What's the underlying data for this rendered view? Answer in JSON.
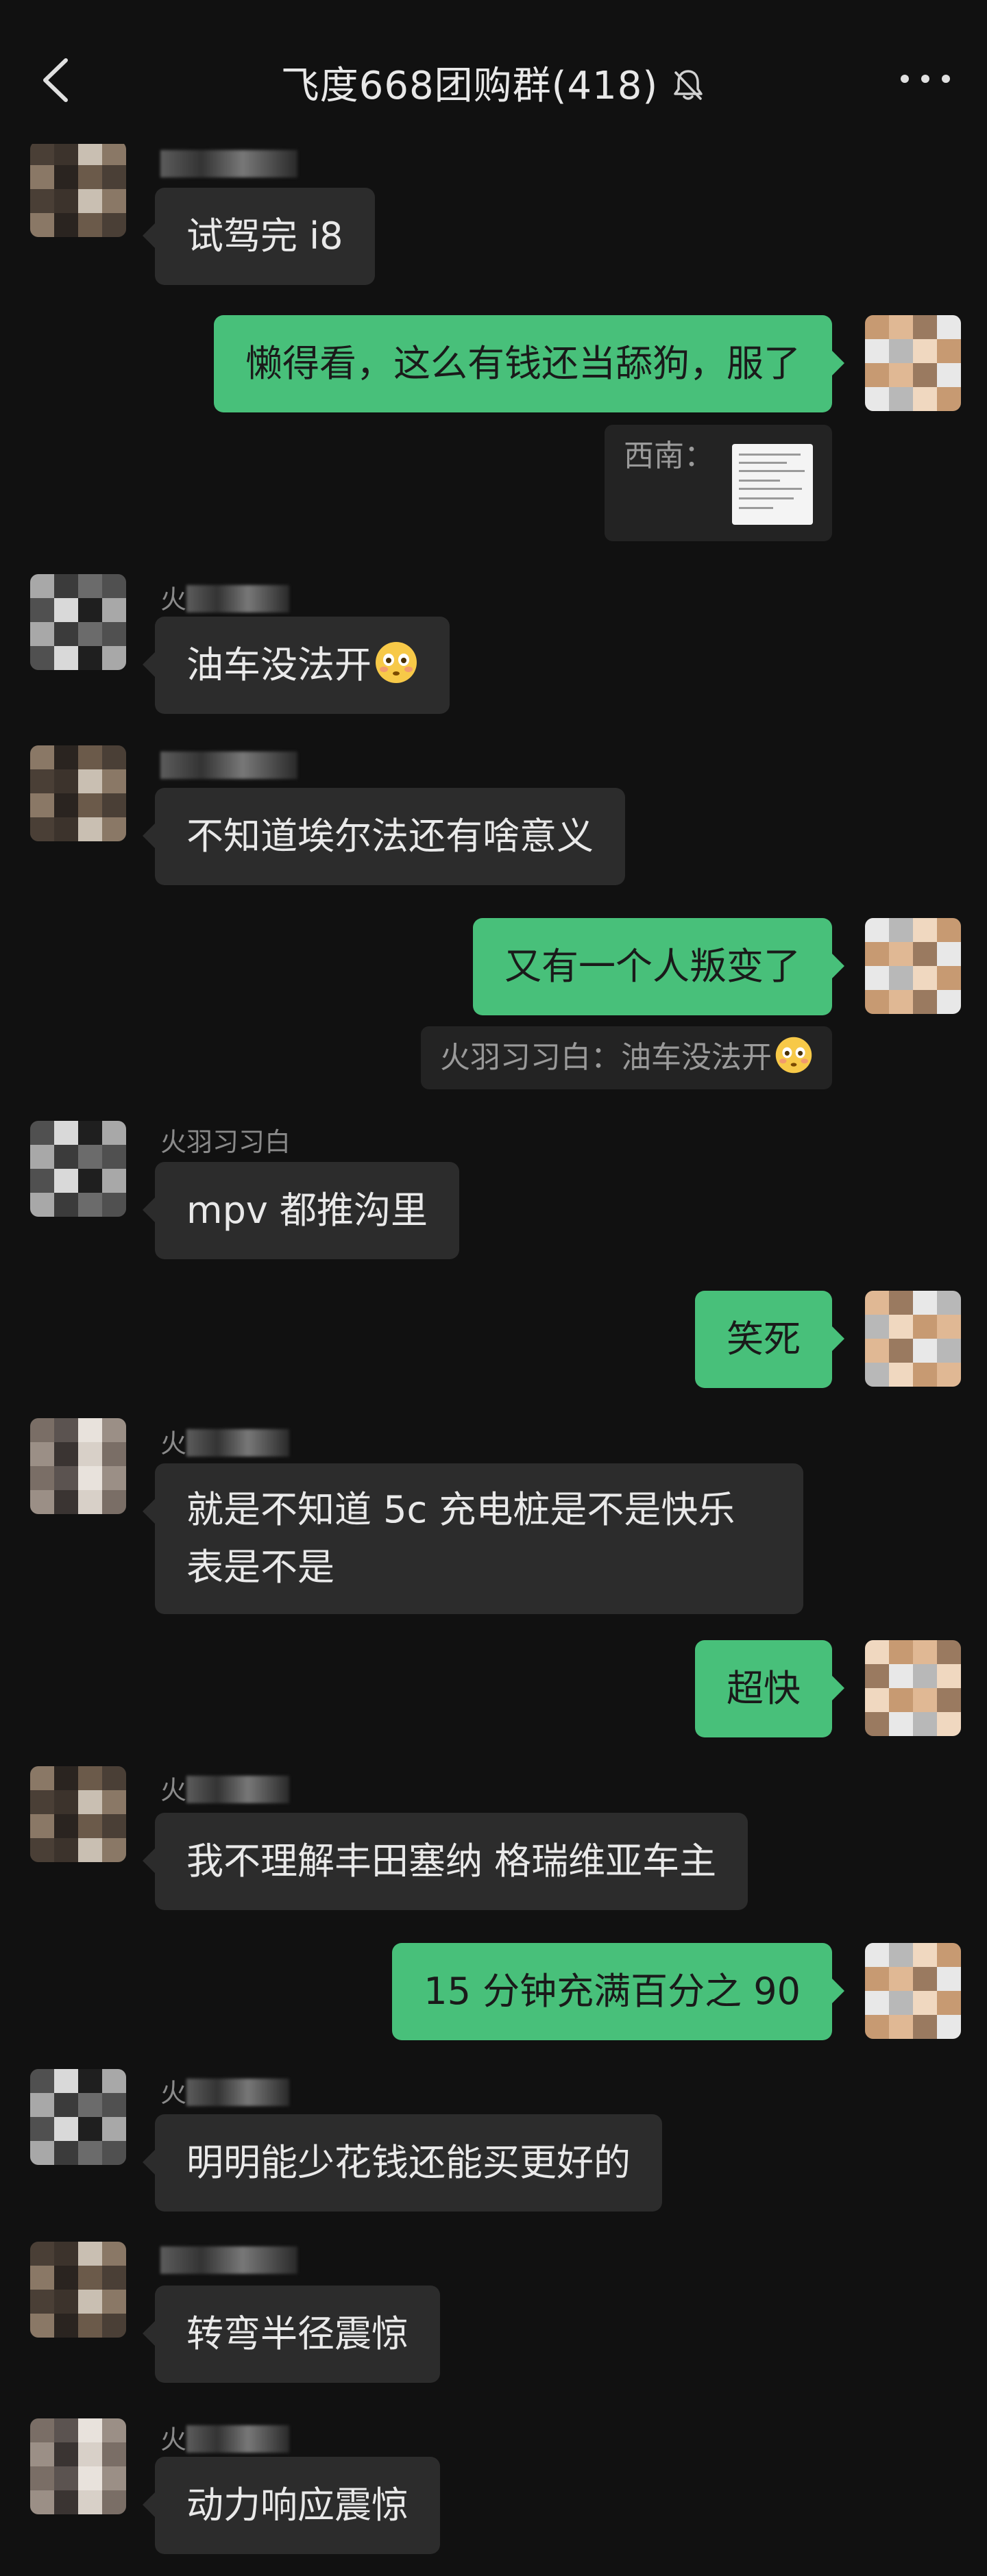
{
  "header": {
    "title": "飞度668团购群(418)",
    "back_icon": "chevron-left-icon",
    "mute_icon": "bell-off-icon",
    "more_icon": "more-dots-icon"
  },
  "messages": [
    {
      "side": "left",
      "sender": "火羽习习白",
      "text": "试驾完 i8"
    },
    {
      "side": "right",
      "text": "懒得看，这么有钱还当舔狗，服了",
      "quote": {
        "label": "西南：",
        "has_image": true
      }
    },
    {
      "side": "left",
      "sender": "火羽习习白",
      "text": "油车没法开",
      "emoji": "flushed-face"
    },
    {
      "side": "left",
      "sender": "火羽习习白",
      "text": "不知道埃尔法还有啥意义"
    },
    {
      "side": "right",
      "text": "又有一个人叛变了",
      "quote": {
        "label": "火羽习习白：油车没法开",
        "emoji": "flushed-face"
      }
    },
    {
      "side": "left",
      "sender": "火羽习习白",
      "text": "mpv 都推沟里"
    },
    {
      "side": "right",
      "text": "笑死"
    },
    {
      "side": "left",
      "sender": "火羽习习白",
      "text": "就是不知道 5c 充电桩是不是快乐表是不是"
    },
    {
      "side": "right",
      "text": "超快"
    },
    {
      "side": "left",
      "sender": "火羽习习白",
      "text": "我不理解丰田塞纳 格瑞维亚车主"
    },
    {
      "side": "right",
      "text": "15 分钟充满百分之 90"
    },
    {
      "side": "left",
      "sender": "火羽习习白",
      "text": "明明能少花钱还能买更好的"
    },
    {
      "side": "left",
      "sender": "火羽习习白",
      "text": "转弯半径震惊"
    },
    {
      "side": "left",
      "sender": "火羽习习白",
      "text": "动力响应震惊"
    }
  ],
  "multiline_text": {
    "m8_line1": "就是不知道 5c 充电桩是不是快乐",
    "m8_line2": "表是不是"
  },
  "colors": {
    "background": "#111111",
    "incoming_bubble": "#2c2c2c",
    "outgoing_bubble": "#48c07a",
    "sender_name": "#8a8a8a"
  }
}
